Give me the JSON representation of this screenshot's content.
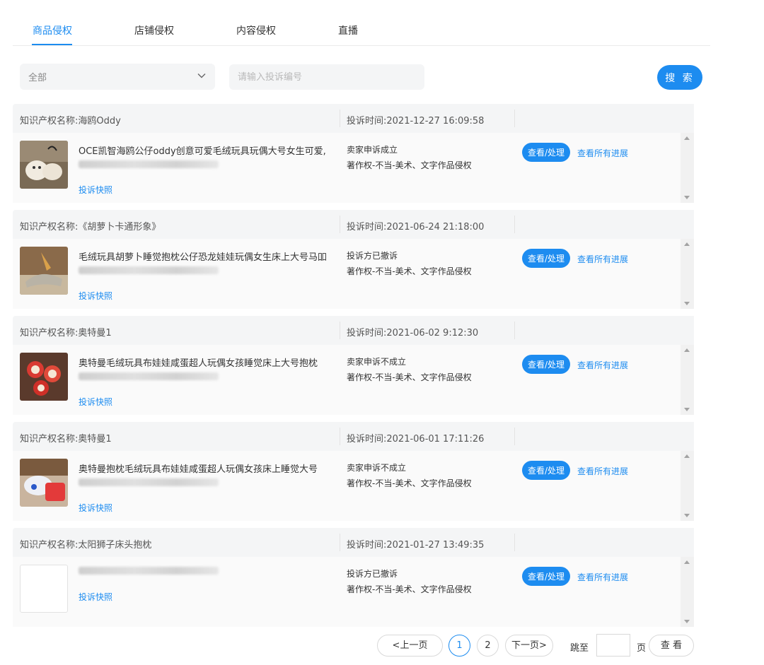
{
  "tabs": [
    {
      "label": "商品侵权",
      "active": true
    },
    {
      "label": "店铺侵权",
      "active": false
    },
    {
      "label": "内容侵权",
      "active": false
    },
    {
      "label": "直播",
      "active": false
    }
  ],
  "filter": {
    "select_value": "全部",
    "search_placeholder": "请输入投诉编号",
    "search_button": "搜 索"
  },
  "colors": {
    "accent": "#1d8cf0",
    "header_bg": "#f4f5f6"
  },
  "complaints": [
    {
      "ip_name": "知识产权名称:海鸥Oddy",
      "time": "投诉时间:2021-12-27 16:09:58",
      "product": "OCE凯智海鸥公仔oddy创意可爱毛绒玩具玩偶大号女生可爱,",
      "snapshot": "投诉快照",
      "status": "卖家申诉成立",
      "type": "著作权-不当-美术、文字作品侵权",
      "action": "查看/处理",
      "progress": "查看所有进展"
    },
    {
      "ip_name": "知识产权名称:《胡萝卜卡通形象》",
      "time": "投诉时间:2021-06-24 21:18:00",
      "product": "毛绒玩具胡萝卜睡觉抱枕公仔恐龙娃娃玩偶女生床上大号马吅",
      "snapshot": "投诉快照",
      "status": "投诉方已撤诉",
      "type": "著作权-不当-美术、文字作品侵权",
      "action": "查看/处理",
      "progress": "查看所有进展"
    },
    {
      "ip_name": "知识产权名称:奥特曼1",
      "time": "投诉时间:2021-06-02 9:12:30",
      "product": "奥特曼毛绒玩具布娃娃咸蛋超人玩偶女孩睡觉床上大号抱枕",
      "snapshot": "投诉快照",
      "status": "卖家申诉不成立",
      "type": "著作权-不当-美术、文字作品侵权",
      "action": "查看/处理",
      "progress": "查看所有进展"
    },
    {
      "ip_name": "知识产权名称:奥特曼1",
      "time": "投诉时间:2021-06-01 17:11:26",
      "product": "奥特曼抱枕毛绒玩具布娃娃咸蛋超人玩偶女孩床上睡觉大号",
      "snapshot": "投诉快照",
      "status": "卖家申诉不成立",
      "type": "著作权-不当-美术、文字作品侵权",
      "action": "查看/处理",
      "progress": "查看所有进展"
    },
    {
      "ip_name": "知识产权名称:太阳狮子床头抱枕",
      "time": "投诉时间:2021-01-27 13:49:35",
      "product": "",
      "snapshot": "投诉快照",
      "status": "投诉方已撤诉",
      "type": "著作权-不当-美术、文字作品侵权",
      "action": "查看/处理",
      "progress": "查看所有进展"
    }
  ],
  "pagination": {
    "prev": "<上一页",
    "pages": [
      "1",
      "2"
    ],
    "current_page": "1",
    "next": "下一页>",
    "jump_to": "跳至",
    "page_unit": "页",
    "go": "查 看"
  }
}
